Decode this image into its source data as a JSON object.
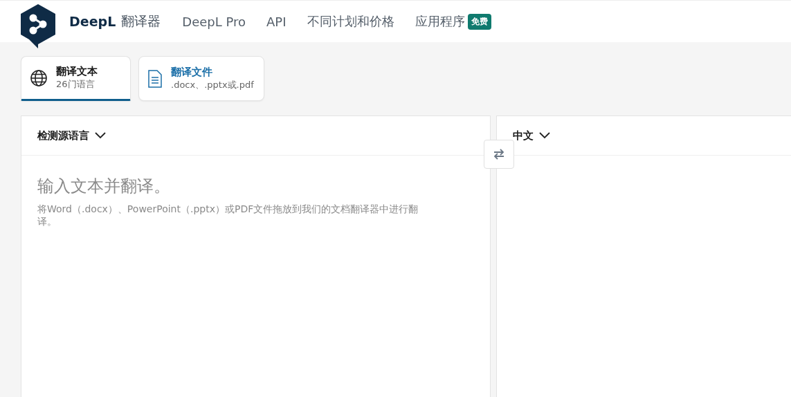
{
  "header": {
    "brand": "DeepL",
    "product": "翻译器",
    "nav": [
      {
        "label": "DeepL Pro"
      },
      {
        "label": "API"
      },
      {
        "label": "不同计划和价格"
      },
      {
        "label": "应用程序",
        "badge": "免费"
      }
    ]
  },
  "mode_tabs": [
    {
      "kind": "text",
      "title": "翻译文本",
      "subtitle": "26门语言",
      "selected": true
    },
    {
      "kind": "file",
      "title": "翻译文件",
      "subtitle": ".docx、.pptx或.pdf",
      "selected": false
    }
  ],
  "source": {
    "language": "检测源语言",
    "placeholder": "输入文本并翻译。",
    "hint": "将Word（.docx）、PowerPoint（.pptx）或PDF文件拖放到我们的文档翻译器中进行翻译。"
  },
  "target": {
    "language": "中文"
  }
}
